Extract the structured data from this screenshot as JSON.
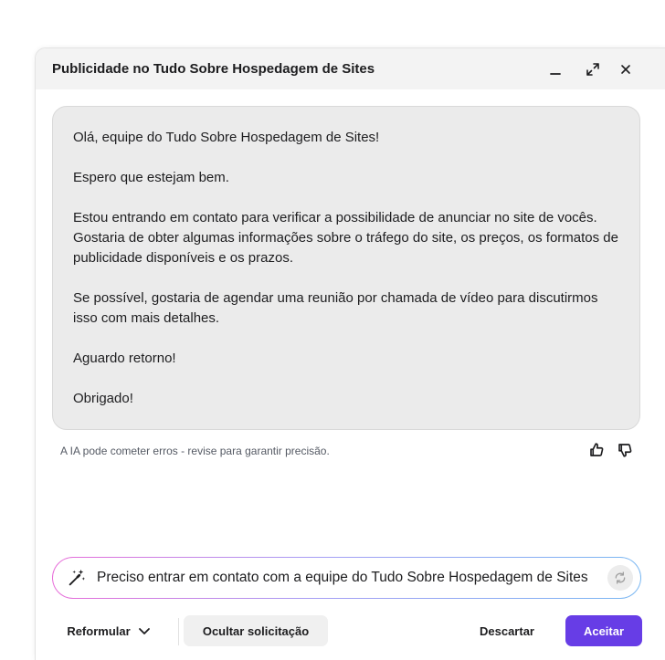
{
  "dialog": {
    "title": "Publicidade no Tudo Sobre Hospedagem de Sites",
    "minimize_label": "_",
    "expand_icon": "expand-icon",
    "close_icon": "close-icon"
  },
  "message": {
    "paragraphs": [
      "Olá, equipe do Tudo Sobre Hospedagem de Sites!",
      "Espero que estejam bem.",
      "Estou entrando em contato para verificar a possibilidade de anunciar no site de vocês. Gostaria de obter algumas informações sobre o tráfego do site, os preços, os formatos de publicidade disponíveis e os prazos.",
      "Se possível, gostaria de agendar uma reunião por chamada de vídeo para discutirmos isso com mais detalhes.",
      "Aguardo retorno!",
      "Obrigado!"
    ]
  },
  "disclaimer": "A IA pode cometer erros - revise para garantir precisão.",
  "prompt": {
    "value": "Preciso entrar em contato com a equipe do Tudo Sobre Hospedagem de Sites"
  },
  "actions": {
    "reformulate": "Reformular",
    "hide_request": "Ocultar solicitação",
    "discard": "Descartar",
    "accept": "Aceitar"
  },
  "colors": {
    "accent": "#673de6",
    "message_bg": "#ebebeb",
    "header_bg": "#f3f3f3"
  }
}
